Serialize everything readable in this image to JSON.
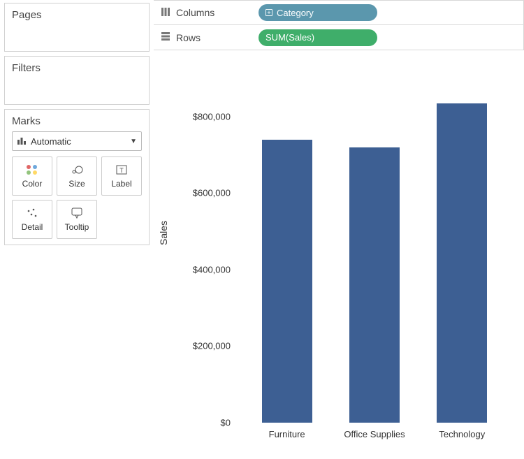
{
  "side": {
    "pages_label": "Pages",
    "filters_label": "Filters",
    "marks_label": "Marks",
    "mark_type": "Automatic",
    "cards": {
      "color": "Color",
      "size": "Size",
      "label": "Label",
      "detail": "Detail",
      "tooltip": "Tooltip"
    }
  },
  "shelves": {
    "columns_label": "Columns",
    "rows_label": "Rows",
    "columns_pill": "Category",
    "rows_pill": "SUM(Sales)"
  },
  "chart_data": {
    "type": "bar",
    "ylabel": "Sales",
    "categories": [
      "Furniture",
      "Office Supplies",
      "Technology"
    ],
    "values": [
      740000,
      720000,
      835000
    ],
    "y_ticks": [
      {
        "value": 0,
        "label": "$0"
      },
      {
        "value": 200000,
        "label": "$200,000"
      },
      {
        "value": 400000,
        "label": "$400,000"
      },
      {
        "value": 600000,
        "label": "$600,000"
      },
      {
        "value": 800000,
        "label": "$800,000"
      }
    ],
    "ylim": [
      0,
      900000
    ]
  }
}
